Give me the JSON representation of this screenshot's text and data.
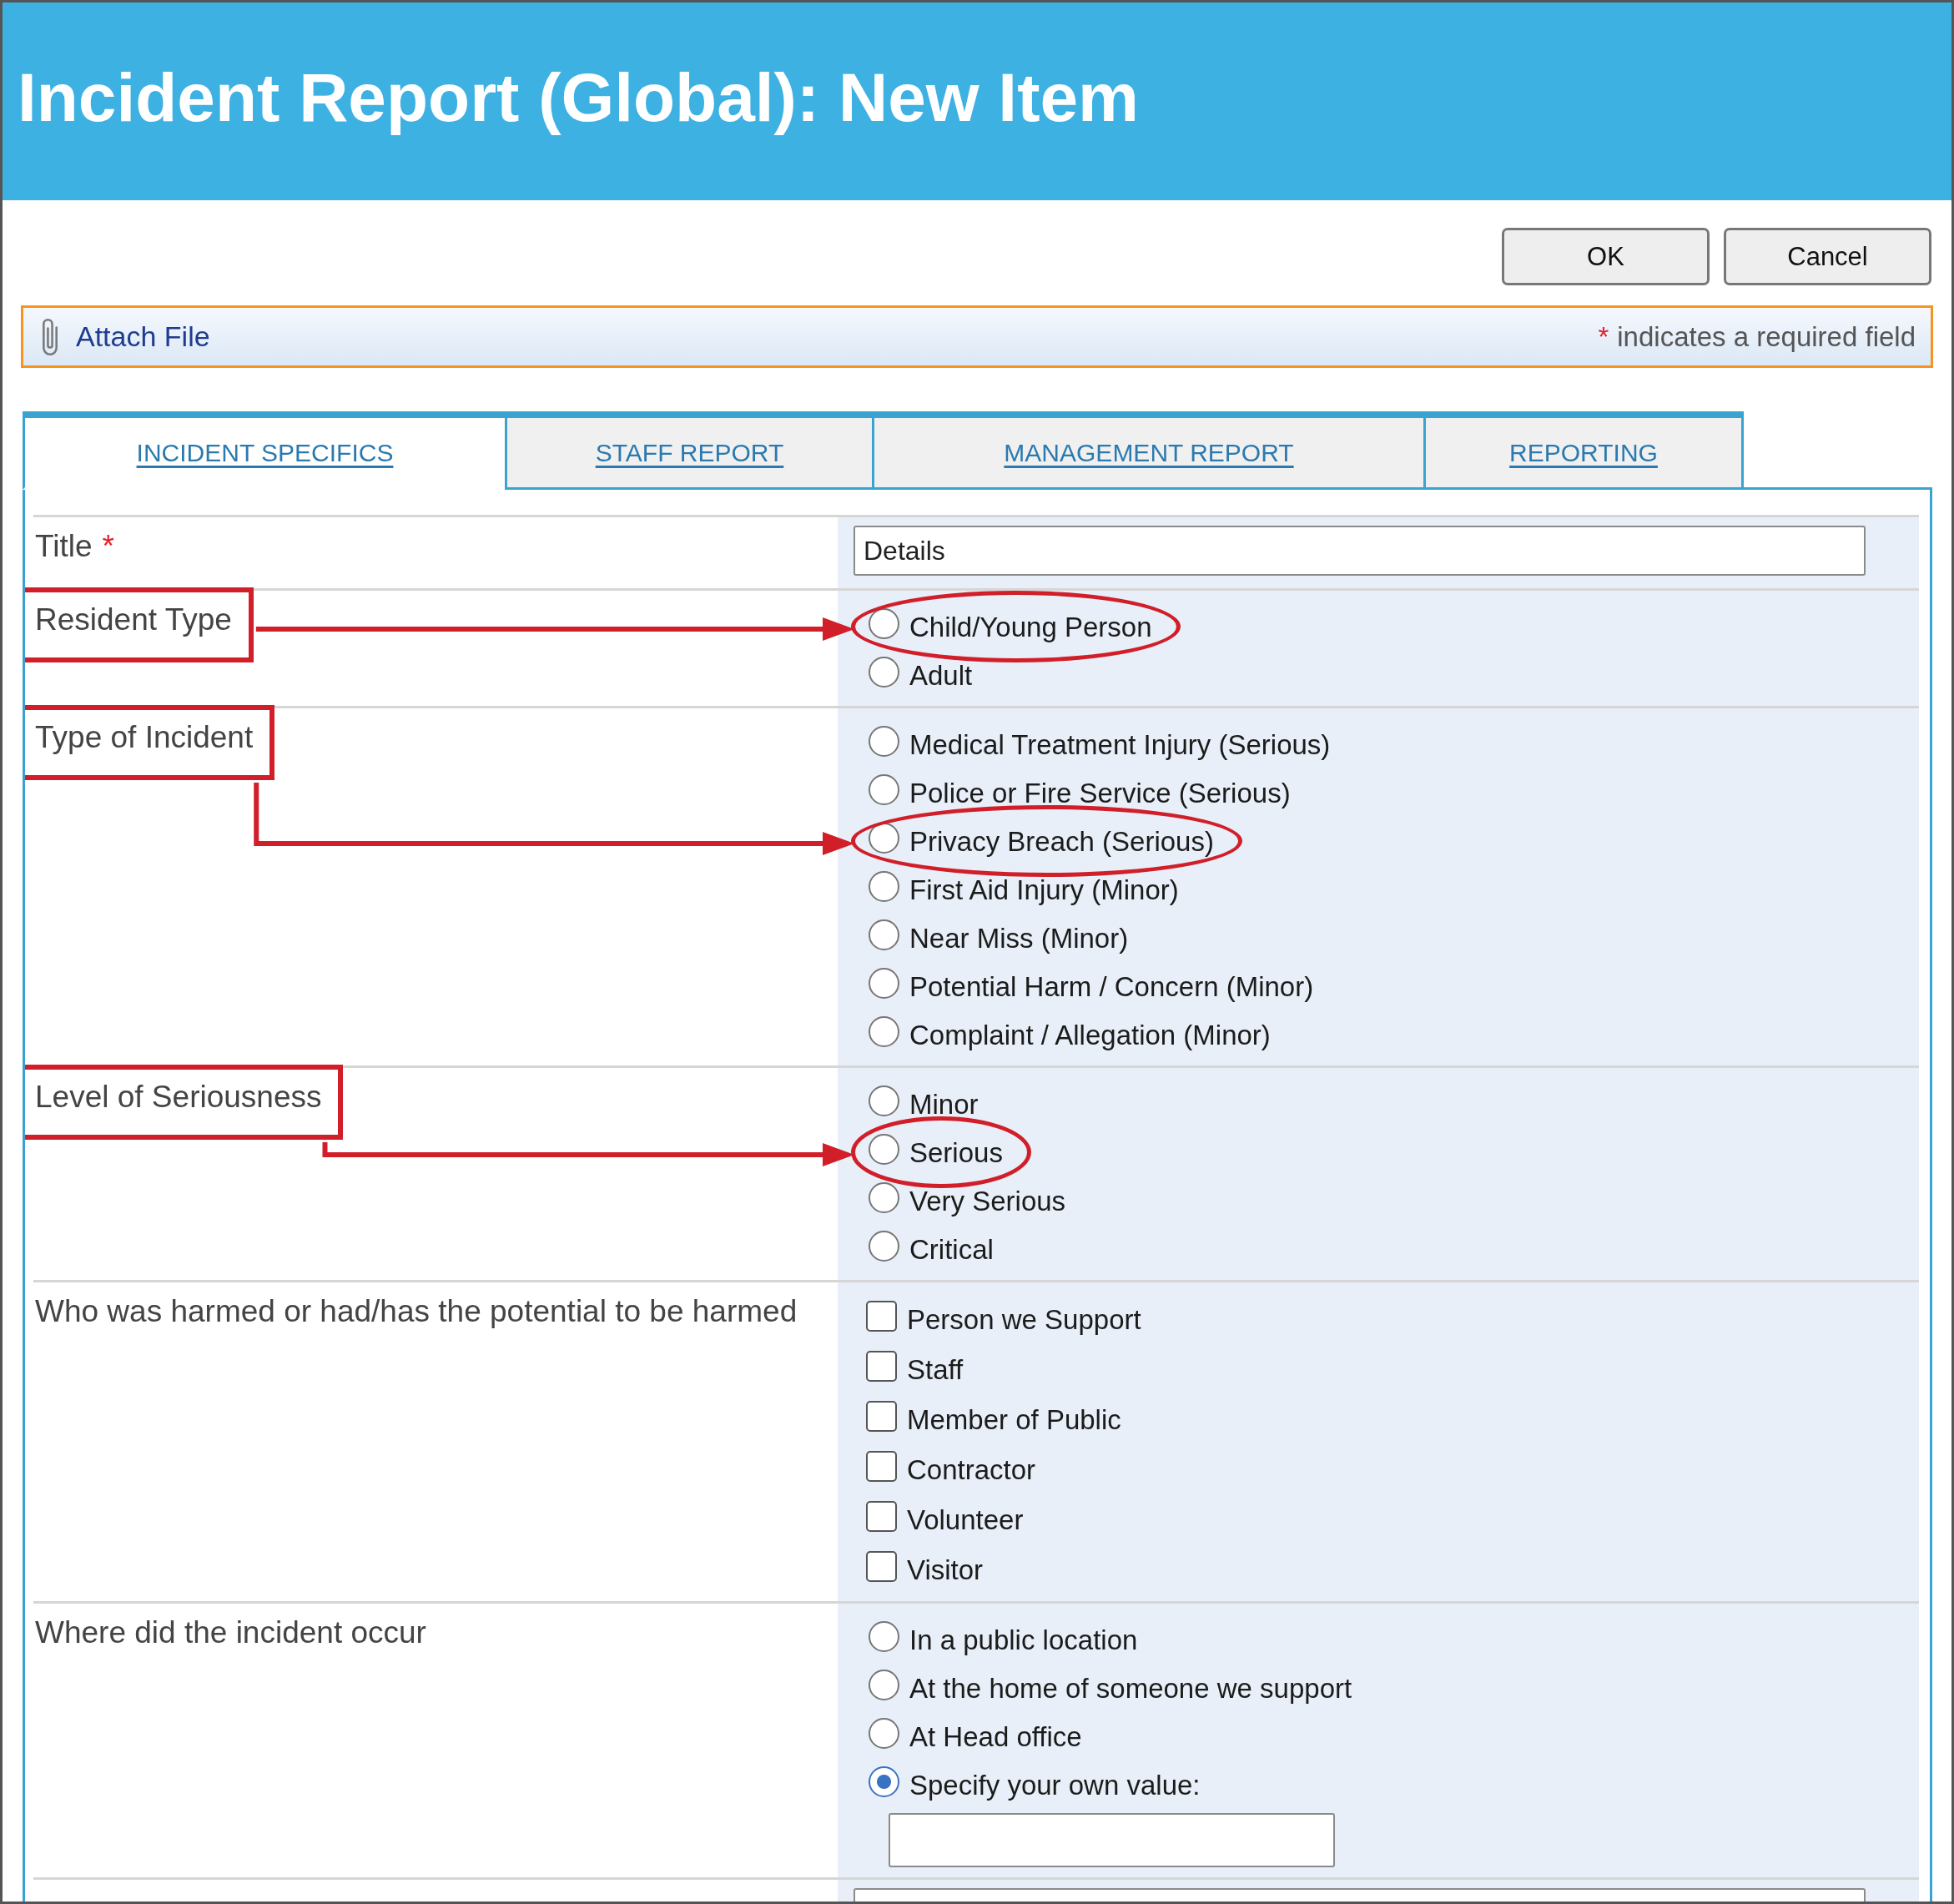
{
  "window": {
    "title": "Incident Report (Global): New Item"
  },
  "toolbar": {
    "buttons": [
      "OK",
      "Cancel"
    ]
  },
  "attach_bar": {
    "link": "Attach File",
    "required_mark": "*",
    "required_note": "indicates a required field"
  },
  "tabs": [
    {
      "label": "INCIDENT SPECIFICS",
      "selected": true
    },
    {
      "label": "STAFF REPORT",
      "selected": false
    },
    {
      "label": "MANAGEMENT REPORT",
      "selected": false
    },
    {
      "label": "REPORTING",
      "selected": false
    }
  ],
  "form": {
    "rows": [
      {
        "kind": "text",
        "label": "Title",
        "required_mark": "*",
        "boxed": false,
        "value": "Details"
      },
      {
        "kind": "radio",
        "label": "Resident Type",
        "boxed": true,
        "options": [
          {
            "label": "Child/Young Person",
            "selected": false,
            "circled": true
          },
          {
            "label": "Adult",
            "selected": false,
            "circled": false
          }
        ]
      },
      {
        "kind": "radio",
        "label": "Type of Incident",
        "boxed": true,
        "options": [
          {
            "label": "Medical Treatment Injury (Serious)",
            "selected": false,
            "circled": false
          },
          {
            "label": "Police or Fire Service (Serious)",
            "selected": false,
            "circled": false
          },
          {
            "label": "Privacy Breach (Serious)",
            "selected": false,
            "circled": true
          },
          {
            "label": "First Aid Injury (Minor)",
            "selected": false,
            "circled": false
          },
          {
            "label": "Near Miss (Minor)",
            "selected": false,
            "circled": false
          },
          {
            "label": "Potential Harm / Concern (Minor)",
            "selected": false,
            "circled": false
          },
          {
            "label": "Complaint / Allegation (Minor)",
            "selected": false,
            "circled": false
          }
        ]
      },
      {
        "kind": "radio",
        "label": "Level of Seriousness",
        "boxed": true,
        "options": [
          {
            "label": "Minor",
            "selected": false,
            "circled": false
          },
          {
            "label": "Serious",
            "selected": false,
            "circled": true
          },
          {
            "label": "Very Serious",
            "selected": false,
            "circled": false
          },
          {
            "label": "Critical",
            "selected": false,
            "circled": false
          }
        ]
      },
      {
        "kind": "checkbox",
        "label": "Who was harmed or had/has the potential to be harmed",
        "boxed": false,
        "options": [
          {
            "label": "Person we Support",
            "checked": false
          },
          {
            "label": "Staff",
            "checked": false
          },
          {
            "label": "Member of Public",
            "checked": false
          },
          {
            "label": "Contractor",
            "checked": false
          },
          {
            "label": "Volunteer",
            "checked": false
          },
          {
            "label": "Visitor",
            "checked": false
          }
        ]
      },
      {
        "kind": "radio",
        "label": "Where did the incident occur",
        "boxed": false,
        "options": [
          {
            "kind": "choice",
            "label": "In a public location",
            "selected": false,
            "circled": false
          },
          {
            "kind": "choice",
            "label": "At the home of someone we support",
            "selected": false,
            "circled": false
          },
          {
            "kind": "choice",
            "label": "At Head office",
            "selected": false,
            "circled": false
          },
          {
            "kind": "custom",
            "label": "Specify your own value:",
            "selected": true,
            "circled": false
          }
        ]
      },
      {
        "kind": "text",
        "boxed": false
      }
    ]
  }
}
